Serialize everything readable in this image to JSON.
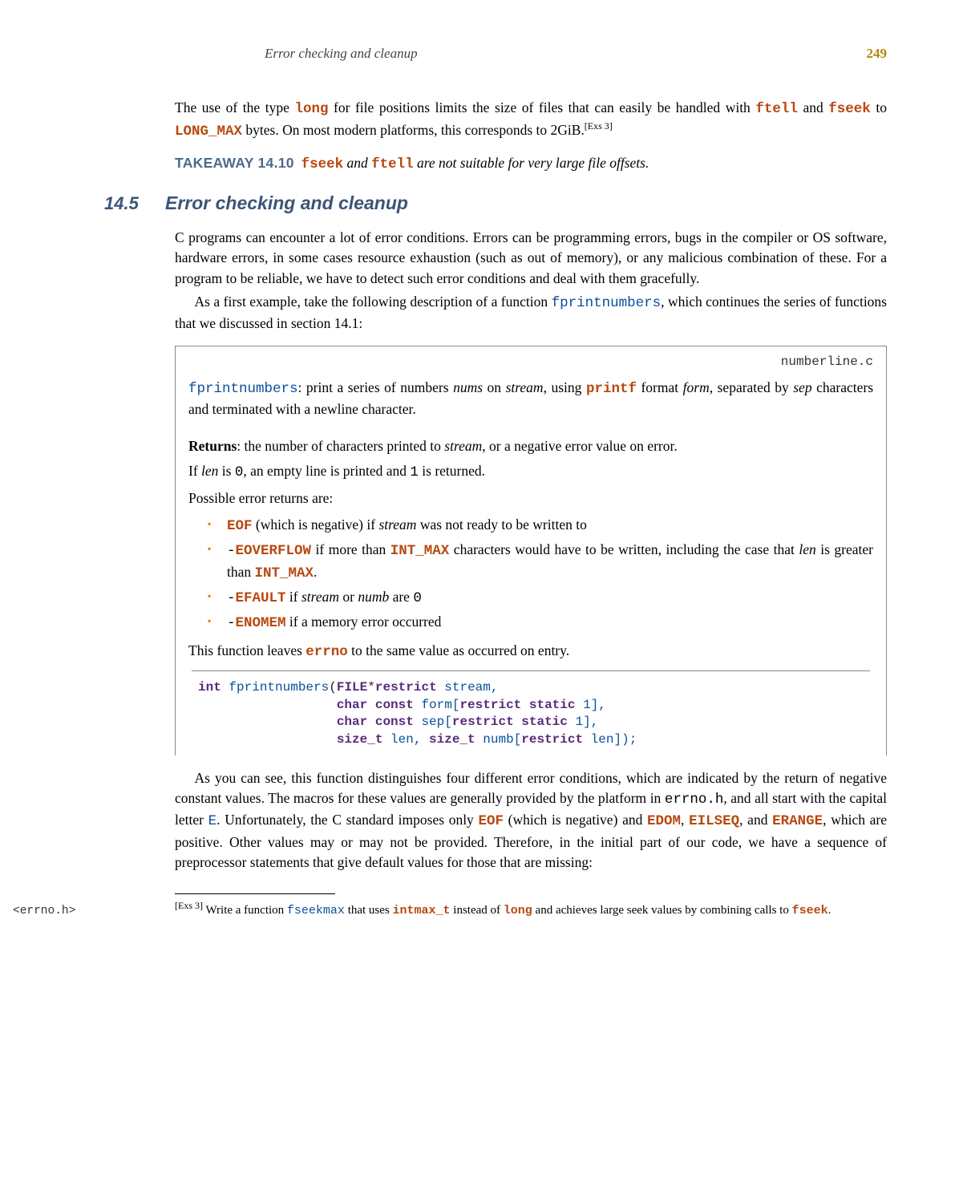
{
  "header": {
    "title": "Error checking and cleanup",
    "page_number": "249"
  },
  "para1": {
    "t1": "The use of the type ",
    "long": "long",
    "t2": " for file positions limits the size of files that can easily be handled with ",
    "ftell": "ftell",
    "t3": " and ",
    "fseek": "fseek",
    "t4": " to ",
    "longmax": "LONG_MAX",
    "t5": " bytes. On most modern platforms, this corresponds to 2GiB.",
    "sup": "[Exs 3]"
  },
  "takeaway": {
    "label": "TAKEAWAY 14.10",
    "fseek": "fseek",
    "mid": " and ",
    "ftell": "ftell",
    "rest": " are not suitable for very large file offsets."
  },
  "section": {
    "num": "14.5",
    "title": "Error checking and cleanup"
  },
  "para2a": "C programs can encounter a lot of error conditions. Errors can be programming errors, bugs in the compiler or OS software, hardware errors, in some cases resource exhaustion (such as out of memory), or any malicious combination of these. For a program to be reliable, we have to detect such error conditions and deal with them gracefully.",
  "para2b": {
    "t1": "As a first example, take the following description of a function ",
    "fn": "fprintnumbers",
    "t2": ", which continues the series of functions that we discussed in section 14.1:"
  },
  "box": {
    "filename": "numberline.c",
    "desc": {
      "fn": "fprintnumbers",
      "t1": ": print a series of numbers ",
      "nums": "nums",
      "t2": " on ",
      "stream": "stream",
      "t3": ", using ",
      "printf": "printf",
      "t4": " format ",
      "form": "form",
      "t5": ", separated by ",
      "sep": "sep",
      "t6": " characters and terminated with a newline character."
    },
    "returns": {
      "label": "Returns",
      "t": ":  the number of characters printed to ",
      "stream": "stream",
      "t2": ", or a negative error value on error."
    },
    "iflen": {
      "t1": "If ",
      "len": "len",
      "t2": " is ",
      "zero": "0",
      "t3": ", an empty line is printed and ",
      "one": "1",
      "t4": " is returned."
    },
    "possible": "Possible error returns are:",
    "items": {
      "eof": {
        "code": "EOF",
        "t1": " (which is negative) if ",
        "stream": "stream",
        "t2": " was not ready to be written to"
      },
      "eoverflow": {
        "pre": "-",
        "code": "EOVERFLOW",
        "t1": " if more than ",
        "intmax": "INT_MAX",
        "t2": " characters would have to be written, including the case that ",
        "len": "len",
        "t3": " is greater than ",
        "intmax2": "INT_MAX",
        "t4": "."
      },
      "efault": {
        "pre": "-",
        "code": "EFAULT",
        "t1": " if ",
        "stream": "stream",
        "t2": " or ",
        "numb": "numb",
        "t3": " are ",
        "zero": "0"
      },
      "enomem": {
        "pre": "-",
        "code": "ENOMEM",
        "t1": " if a memory error occurred"
      }
    },
    "leaves": {
      "t1": "This function leaves ",
      "errno": "errno",
      "t2": " to the same value as occurred on entry."
    },
    "code": {
      "l1a": "int",
      "l1b": " fprintnumbers",
      "l1c": "(",
      "l1d": "FILE",
      "l1e": "*",
      "l1f": "restrict",
      "l1g": " stream,",
      "l2a": "                  char const",
      "l2b": " form[",
      "l2c": "restrict static",
      "l2d": " 1],",
      "l3a": "                  char const",
      "l3b": " sep[",
      "l3c": "restrict static",
      "l3d": " 1],",
      "l4a": "                  size_t",
      "l4b": " len, ",
      "l4c": "size_t",
      "l4d": " numb[",
      "l4e": "restrict",
      "l4f": " len]);"
    }
  },
  "para3": {
    "t1": "As you can see, this function distinguishes four different error conditions, which are indicated by the return of negative constant values. The macros for these values are generally provided by the platform in ",
    "errnoh": "errno.h",
    "t2": ", and all start with the capital letter ",
    "E": "E",
    "t3": ". Unfortunately, the C standard imposes only ",
    "EOF": "EOF",
    "t4": " (which is negative) and ",
    "EDOM": "EDOM",
    "c1": ", ",
    "EILSEQ": "EILSEQ",
    "t5": ", and ",
    "ERANGE": "ERANGE",
    "t6": ", which are positive. Other values may or may not be provided. Therefore, in the initial part of our code, we have a sequence of preprocessor statements that give default values for those that are missing:"
  },
  "margin_note": "<errno.h>",
  "footnote": {
    "sup": "[Exs 3]",
    "t1": "  Write a function ",
    "fseekmax": "fseekmax",
    "t2": " that uses ",
    "intmax_t": "intmax_t",
    "t3": " instead of ",
    "long": "long",
    "t4": " and achieves large seek values by combining calls to ",
    "fseek": "fseek",
    "t5": "."
  }
}
